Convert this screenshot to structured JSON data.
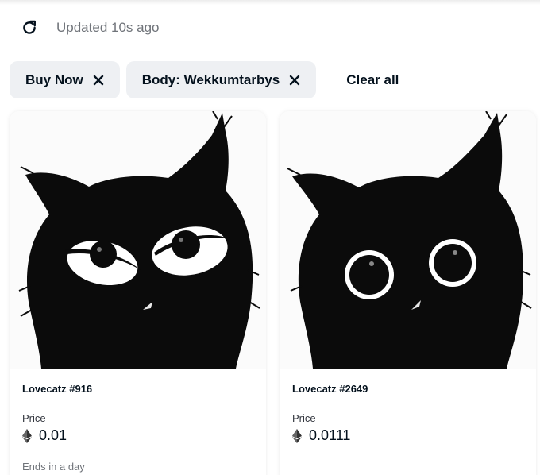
{
  "status": {
    "updated_text": "Updated 10s ago"
  },
  "filters": {
    "chips": [
      {
        "label": "Buy Now"
      },
      {
        "label": "Body: Wekkumtarbys"
      }
    ],
    "clear_all_label": "Clear all"
  },
  "cards": [
    {
      "name": "Lovecatz #916",
      "price_label": "Price",
      "price": "0.01",
      "ends": "Ends in a day",
      "eyes": "angry"
    },
    {
      "name": "Lovecatz #2649",
      "price_label": "Price",
      "price": "0.0111",
      "ends": "",
      "eyes": "round"
    }
  ],
  "icons": {
    "refresh": "refresh-icon",
    "close": "close-icon",
    "currency": "ethereum-icon"
  },
  "colors": {
    "text_primary": "#04111d",
    "text_secondary": "#70747a",
    "chip_bg": "#eef0f3"
  }
}
